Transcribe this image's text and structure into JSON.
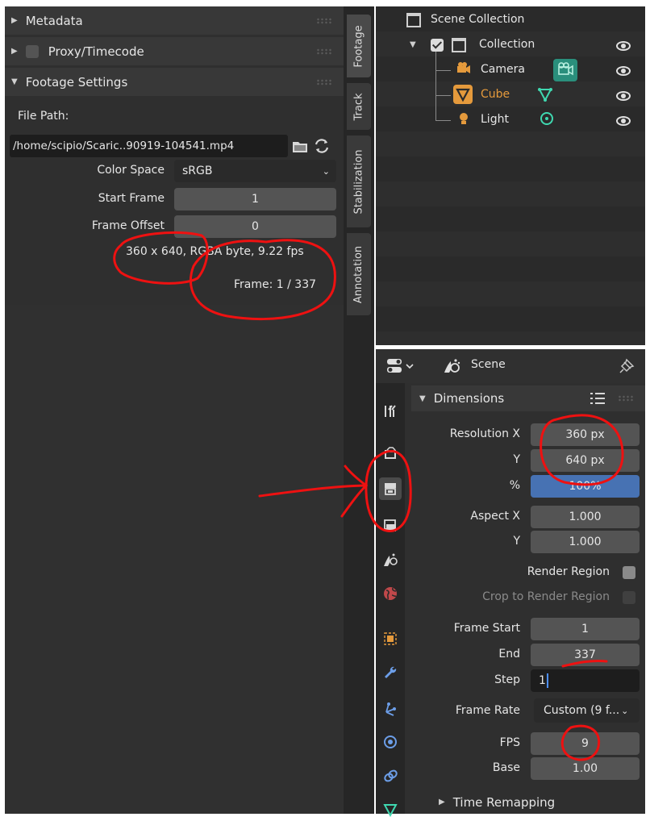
{
  "clip_panel": {
    "sections": {
      "metadata": "Metadata",
      "proxy": "Proxy/Timecode",
      "footage_settings": "Footage Settings"
    },
    "file_path_label": "File Path:",
    "file_path_value": "/home/scipio/Scaric..90919-104541.mp4",
    "color_space_label": "Color Space",
    "color_space_value": "sRGB",
    "start_frame_label": "Start Frame",
    "start_frame_value": "1",
    "frame_offset_label": "Frame Offset",
    "frame_offset_value": "0",
    "info_line": "360 x 640, RGBA byte, 9.22 fps",
    "frame_line": "Frame: 1 / 337"
  },
  "vertical_tabs": [
    "Footage",
    "Track",
    "Stabilization",
    "Annotation"
  ],
  "outliner": {
    "root": "Scene Collection",
    "collection": "Collection",
    "items": [
      {
        "name": "Camera"
      },
      {
        "name": "Cube"
      },
      {
        "name": "Light"
      }
    ]
  },
  "properties": {
    "scene_label": "Scene",
    "dimensions_header": "Dimensions",
    "resolution_x_label": "Resolution X",
    "resolution_x": "360 px",
    "resolution_y_label": "Y",
    "resolution_y": "640 px",
    "percent_label": "%",
    "percent_value": "100%",
    "aspect_x_label": "Aspect X",
    "aspect_x": "1.000",
    "aspect_y_label": "Y",
    "aspect_y": "1.000",
    "render_region_label": "Render Region",
    "crop_region_label": "Crop to Render Region",
    "frame_start_label": "Frame Start",
    "frame_start": "1",
    "end_label": "End",
    "end_value": "337",
    "step_label": "Step",
    "step_value": "1",
    "frame_rate_label": "Frame Rate",
    "frame_rate_value": "Custom (9 f...",
    "fps_label": "FPS",
    "fps_value": "9",
    "base_label": "Base",
    "base_value": "1.00",
    "time_remapping": "Time Remapping"
  },
  "colors": {
    "panel_bg": "#2f2f2f",
    "field_bg": "#545454",
    "accent_blue": "#4772b3",
    "cube_orange": "#e59a3c",
    "annotation_red": "#ee1111"
  }
}
